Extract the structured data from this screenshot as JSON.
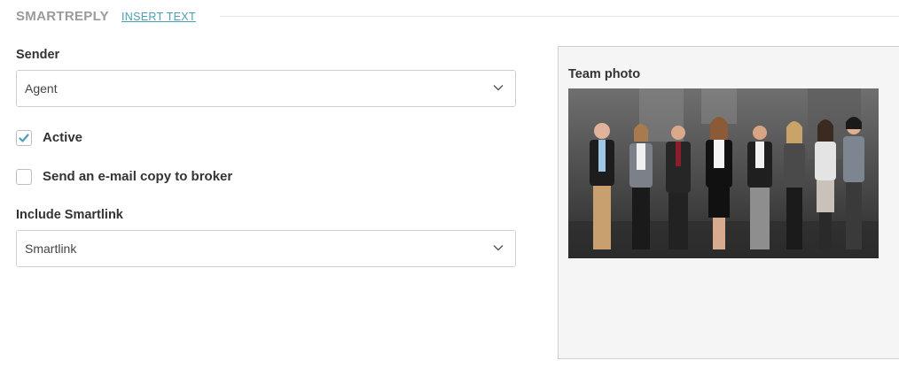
{
  "header": {
    "brand": "SMARTREPLY",
    "insert_text": "INSERT TEXT"
  },
  "form": {
    "sender": {
      "label": "Sender",
      "value": "Agent"
    },
    "active": {
      "label": "Active",
      "checked": true
    },
    "email_copy": {
      "label": "Send an e-mail copy to broker",
      "checked": false
    },
    "smartlink": {
      "label": "Include Smartlink",
      "value": "Smartlink"
    }
  },
  "preview": {
    "title": "Team photo",
    "image_icon": "team-photo"
  },
  "colors": {
    "accent_link": "#4a9fb5",
    "checkmark": "#4a9fb5",
    "panel_bg": "#f5f5f5"
  }
}
